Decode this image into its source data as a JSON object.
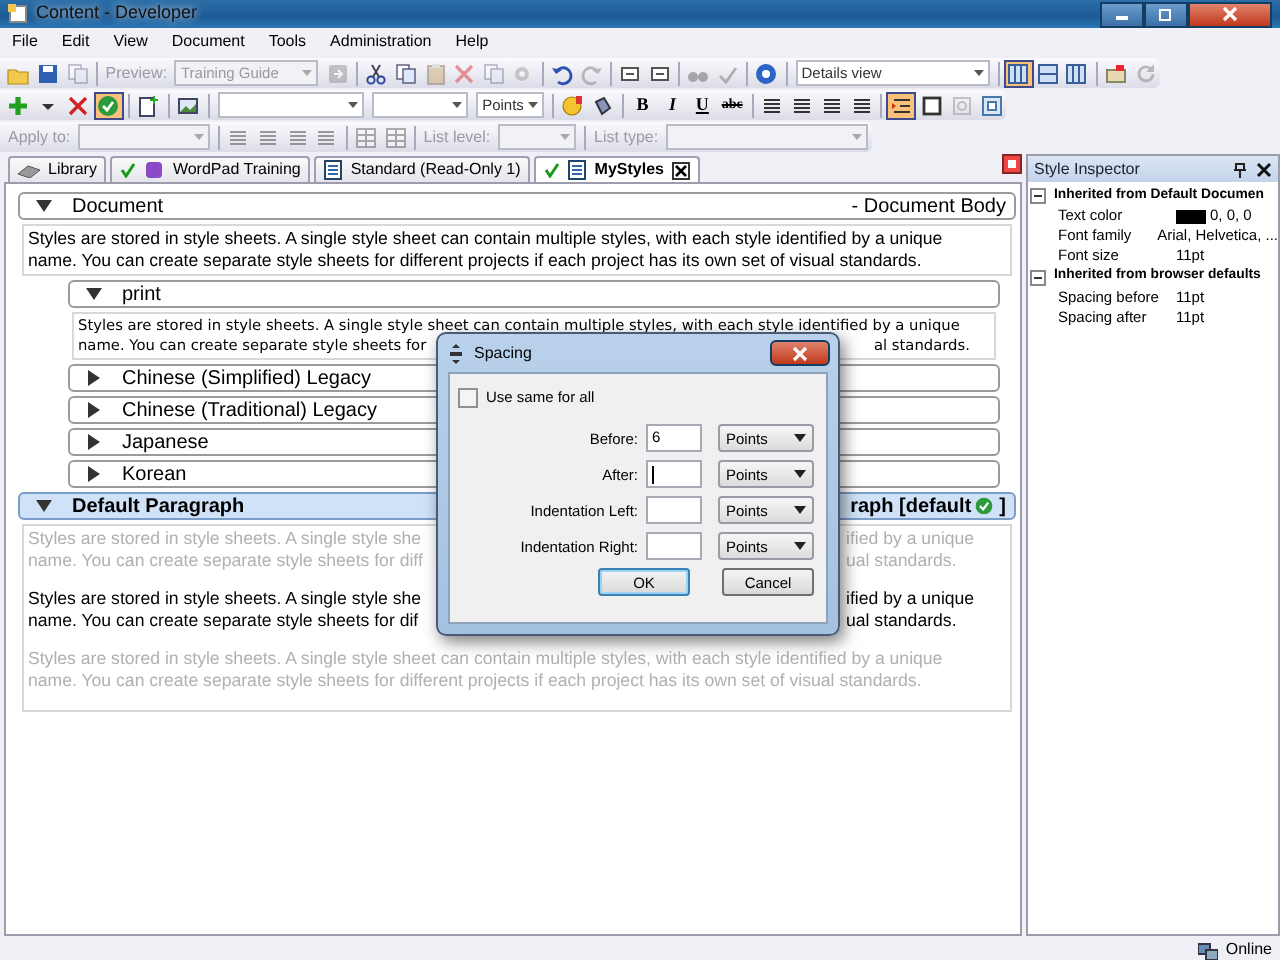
{
  "window": {
    "title": "Content - Developer"
  },
  "menu": [
    "File",
    "Edit",
    "View",
    "Document",
    "Tools",
    "Administration",
    "Help"
  ],
  "toolbars": [
    [
      {
        "kind": "button"
      },
      {
        "kind": "button"
      },
      {
        "kind": "button",
        "disabled": true
      },
      {
        "kind": "sep"
      },
      {
        "kind": "label",
        "text": "Preview:",
        "disabled": true
      },
      {
        "kind": "select",
        "value": "Training Guide",
        "disabled": true
      },
      {
        "kind": "button",
        "disabled": true
      },
      {
        "kind": "sep"
      },
      {
        "kind": "button"
      },
      {
        "kind": "button"
      },
      {
        "kind": "button",
        "disabled": true
      },
      {
        "kind": "button",
        "disabled": true
      },
      {
        "kind": "button",
        "disabled": true
      },
      {
        "kind": "button",
        "disabled": true
      },
      {
        "kind": "sep"
      },
      {
        "kind": "button"
      },
      {
        "kind": "button",
        "disabled": true
      },
      {
        "kind": "sep"
      },
      {
        "kind": "button"
      },
      {
        "kind": "button"
      },
      {
        "kind": "sep"
      },
      {
        "kind": "button",
        "disabled": true
      },
      {
        "kind": "button",
        "disabled": true
      },
      {
        "kind": "sep"
      },
      {
        "kind": "button"
      },
      {
        "kind": "sep"
      },
      {
        "kind": "select",
        "value": "Details view"
      },
      {
        "kind": "sep"
      },
      {
        "kind": "button",
        "pressed": true
      },
      {
        "kind": "button"
      },
      {
        "kind": "button"
      },
      {
        "kind": "sep"
      },
      {
        "kind": "button"
      },
      {
        "kind": "button",
        "disabled": true
      }
    ],
    [
      {
        "kind": "button"
      },
      {
        "kind": "button"
      },
      {
        "kind": "button"
      },
      {
        "kind": "button",
        "pressed": true
      },
      {
        "kind": "sep"
      },
      {
        "kind": "button"
      },
      {
        "kind": "sep"
      },
      {
        "kind": "button"
      },
      {
        "kind": "sep"
      },
      {
        "kind": "select"
      },
      {
        "kind": "select"
      },
      {
        "kind": "select",
        "value": "Points"
      },
      {
        "kind": "sep"
      },
      {
        "kind": "button"
      },
      {
        "kind": "button"
      },
      {
        "kind": "sep"
      },
      {
        "kind": "format",
        "text": "B"
      },
      {
        "kind": "format",
        "text": "I"
      },
      {
        "kind": "format",
        "text": "U"
      },
      {
        "kind": "format",
        "text": "abc"
      },
      {
        "kind": "sep"
      },
      {
        "kind": "button"
      },
      {
        "kind": "button"
      },
      {
        "kind": "button"
      },
      {
        "kind": "button"
      },
      {
        "kind": "sep"
      },
      {
        "kind": "button",
        "pressed": true
      },
      {
        "kind": "button"
      },
      {
        "kind": "button",
        "disabled": true
      },
      {
        "kind": "button"
      }
    ],
    [
      {
        "kind": "label",
        "text": "Apply to:",
        "disabled": true
      },
      {
        "kind": "select",
        "disabled": true
      },
      {
        "kind": "sep"
      },
      {
        "kind": "button",
        "disabled": true
      },
      {
        "kind": "button",
        "disabled": true
      },
      {
        "kind": "button",
        "disabled": true
      },
      {
        "kind": "button",
        "disabled": true
      },
      {
        "kind": "sep"
      },
      {
        "kind": "button",
        "disabled": true
      },
      {
        "kind": "button",
        "disabled": true
      },
      {
        "kind": "sep"
      },
      {
        "kind": "label",
        "text": "List level:",
        "disabled": true
      },
      {
        "kind": "select",
        "disabled": true
      },
      {
        "kind": "sep"
      },
      {
        "kind": "label",
        "text": "List type:",
        "disabled": true
      },
      {
        "kind": "select",
        "disabled": true
      }
    ]
  ],
  "tabs": [
    {
      "label": "Library",
      "selected": false,
      "checked": false,
      "closable": false
    },
    {
      "label": "WordPad Training",
      "selected": false,
      "checked": true,
      "closable": false
    },
    {
      "label": "Standard (Read-Only 1)",
      "selected": false,
      "checked": false,
      "closable": false
    },
    {
      "label": "MyStyles",
      "selected": true,
      "checked": true,
      "closable": true
    }
  ],
  "style_tree": [
    {
      "title": "Document",
      "right_label": "- Document Body",
      "expanded": true,
      "selected": false,
      "paragraphs": [
        {
          "kind": "normal",
          "lines": [
            [
              "Styles are stored in style sheets. A single style sheet can contain multiple styles, with each style identified by a unique"
            ],
            [
              "name. You can create separate style sheets for different projects if each project has its own set of visual standards."
            ]
          ]
        }
      ],
      "children": [
        {
          "title": "print",
          "expanded": true,
          "selected": false,
          "paragraphs": [
            {
              "kind": "wide",
              "lines": [
                [
                  "Styles are stored in style sheets. A single style sheet can contain multiple styles, with each style identified by a unique"
                ],
                [
                  "name. You can create separate style sheets for",
                  "al standards."
                ]
              ]
            }
          ]
        },
        {
          "title": "Chinese (Simplified) Legacy",
          "expanded": false,
          "selected": false
        },
        {
          "title": "Chinese (Traditional) Legacy",
          "expanded": false,
          "selected": false
        },
        {
          "title": "Japanese",
          "expanded": false,
          "selected": false
        },
        {
          "title": "Korean",
          "expanded": false,
          "selected": false
        }
      ]
    },
    {
      "title": "Default Paragraph",
      "right_label": "raph [default",
      "default_mark": true,
      "right_tail": "]",
      "expanded": true,
      "selected": true,
      "paragraphs": [
        {
          "kind": "faded",
          "lines": [
            [
              "Styles are stored in style sheets. A single style she",
              "ified by a unique"
            ],
            [
              "name. You can create separate style sheets for diff",
              "ual standards."
            ]
          ]
        },
        {
          "kind": "normal",
          "lines": [
            [
              "Styles are stored in style sheets. A single style she",
              "ified by a unique"
            ],
            [
              "name. You can create separate style sheets for dif",
              "ual standards."
            ]
          ]
        },
        {
          "kind": "faded",
          "lines": [
            [
              "Styles are stored in style sheets. A single style sheet can contain multiple styles, with each style identified by a unique"
            ],
            [
              "name. You can create separate style sheets for different projects if each project has its own set of visual standards."
            ]
          ]
        }
      ]
    }
  ],
  "inspector": {
    "title": "Style Inspector",
    "groups": [
      {
        "title": "Inherited from Default Documen",
        "expanded": true,
        "properties": [
          {
            "name": "Text color",
            "value": "0, 0, 0",
            "color": "#000000"
          },
          {
            "name": "Font family",
            "value": "Arial, Helvetica, ..."
          },
          {
            "name": "Font size",
            "value": "11pt"
          }
        ]
      },
      {
        "title": "Inherited from browser defaults",
        "expanded": true,
        "properties": [
          {
            "name": "Spacing before",
            "value": "11pt"
          },
          {
            "name": "Spacing after",
            "value": "11pt"
          }
        ]
      }
    ]
  },
  "dialog": {
    "title": "Spacing",
    "checkbox": {
      "label": "Use same for all",
      "checked": false
    },
    "rows": [
      {
        "label": "Before:",
        "value": "6",
        "unit": "Points",
        "focused": false
      },
      {
        "label": "After:",
        "unit": "Points",
        "focused": true
      },
      {
        "label": "Indentation Left:",
        "unit": "Points",
        "focused": false
      },
      {
        "label": "Indentation Right:",
        "unit": "Points",
        "focused": false
      }
    ],
    "buttons": [
      {
        "label": "OK",
        "default": true
      },
      {
        "label": "Cancel",
        "default": false
      }
    ]
  },
  "status_bar": {
    "text": "Online"
  }
}
